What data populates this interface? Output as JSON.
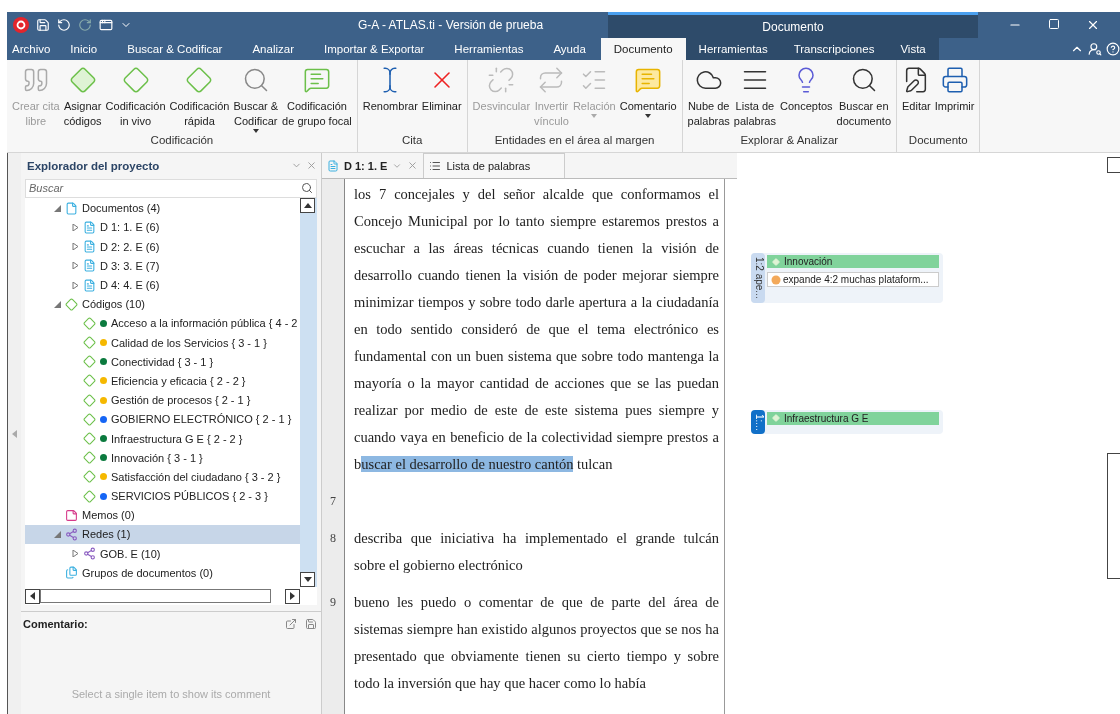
{
  "window": {
    "title": "G-A - ATLAS.ti - Versión de prueba",
    "context_group": "Documento"
  },
  "menu_tabs": [
    {
      "label": "Archivo",
      "selected": false,
      "contextual": false
    },
    {
      "label": "Inicio",
      "selected": false,
      "contextual": false
    },
    {
      "label": "Buscar & Codificar",
      "selected": false,
      "contextual": false
    },
    {
      "label": "Analizar",
      "selected": false,
      "contextual": false
    },
    {
      "label": "Importar & Exportar",
      "selected": false,
      "contextual": false
    },
    {
      "label": "Herramientas",
      "selected": false,
      "contextual": false
    },
    {
      "label": "Ayuda",
      "selected": false,
      "contextual": false
    },
    {
      "label": "Documento",
      "selected": true,
      "contextual": true
    },
    {
      "label": "Herramientas",
      "selected": false,
      "contextual": true
    },
    {
      "label": "Transcripciones",
      "selected": false,
      "contextual": true
    },
    {
      "label": "Vista",
      "selected": false,
      "contextual": true
    }
  ],
  "ribbon": [
    {
      "title": "Codificación",
      "buttons": [
        {
          "label": "Crear cita\nlibre",
          "disabled": true,
          "dropdown": false
        },
        {
          "label": "Asignar\ncódigos",
          "disabled": false,
          "dropdown": false
        },
        {
          "label": "Codificación\nin vivo",
          "disabled": false,
          "dropdown": false
        },
        {
          "label": "Codificación\nrápida",
          "disabled": false,
          "dropdown": false
        },
        {
          "label": "Buscar &\nCodificar",
          "disabled": false,
          "dropdown": true
        },
        {
          "label": "Codificación\nde grupo focal",
          "disabled": false,
          "dropdown": false
        }
      ]
    },
    {
      "title": "Cita",
      "buttons": [
        {
          "label": "Renombrar",
          "disabled": false,
          "dropdown": false
        },
        {
          "label": "Eliminar",
          "disabled": false,
          "dropdown": false
        }
      ]
    },
    {
      "title": "Entidades en el área al margen",
      "buttons": [
        {
          "label": "Desvincular",
          "disabled": true,
          "dropdown": false
        },
        {
          "label": "Invertir\nvínculo",
          "disabled": true,
          "dropdown": false
        },
        {
          "label": "Relación",
          "disabled": true,
          "dropdown": true
        },
        {
          "label": "Comentario",
          "disabled": false,
          "dropdown": true
        }
      ]
    },
    {
      "title": "Explorar & Analizar",
      "buttons": [
        {
          "label": "Nube de\npalabras",
          "disabled": false,
          "dropdown": false
        },
        {
          "label": "Lista de\npalabras",
          "disabled": false,
          "dropdown": false
        },
        {
          "label": "Conceptos",
          "disabled": false,
          "dropdown": false
        },
        {
          "label": "Buscar en\ndocumento",
          "disabled": false,
          "dropdown": false
        }
      ]
    },
    {
      "title": "Documento",
      "buttons": [
        {
          "label": "Editar",
          "disabled": false,
          "dropdown": false
        },
        {
          "label": "Imprimir",
          "disabled": false,
          "dropdown": false
        }
      ]
    }
  ],
  "explorer": {
    "title": "Explorador del proyecto",
    "search": {
      "placeholder": "Buscar"
    },
    "tree": [
      {
        "label": "Documentos (4)",
        "kind": "folder",
        "expanded": true,
        "selected": false,
        "children": [
          {
            "label": "D 1: 1. E (6)",
            "kind": "document",
            "expanded": false,
            "selected": false
          },
          {
            "label": "D 2: 2. E (6)",
            "kind": "document",
            "expanded": false,
            "selected": false
          },
          {
            "label": "D 3: 3. E (7)",
            "kind": "document",
            "expanded": false,
            "selected": false
          },
          {
            "label": "D 4: 4. E (6)",
            "kind": "document",
            "expanded": false,
            "selected": false
          }
        ]
      },
      {
        "label": "Códigos (10)",
        "kind": "codes",
        "expanded": true,
        "selected": false,
        "children": [
          {
            "label": "Acceso a la información pública { 4 - 2",
            "kind": "code",
            "color": "#0b7a3e",
            "selected": false
          },
          {
            "label": "Calidad de los Servicios { 3 - 1 }",
            "kind": "code",
            "color": "#f5b800",
            "selected": false
          },
          {
            "label": "Conectividad { 3 - 1 }",
            "kind": "code",
            "color": "#0b7a3e",
            "selected": false
          },
          {
            "label": "Eficiencia y eficacia { 2 - 2 }",
            "kind": "code",
            "color": "#f5b800",
            "selected": false
          },
          {
            "label": "Gestión de procesos { 2 - 1 }",
            "kind": "code",
            "color": "#f5b800",
            "selected": false
          },
          {
            "label": "GOBIERNO ELECTRÓNICO { 2 - 1 }",
            "kind": "code",
            "color": "#1565f5",
            "selected": false
          },
          {
            "label": "Infraestructura G E { 2 - 2 }",
            "kind": "code",
            "color": "#0b7a3e",
            "selected": false
          },
          {
            "label": "Innovación { 3 - 1 }",
            "kind": "code",
            "color": "#0b7a3e",
            "selected": false
          },
          {
            "label": "Satisfacción del ciudadano { 3 - 2 }",
            "kind": "code",
            "color": "#f5b800",
            "selected": false
          },
          {
            "label": "SERVICIOS PÚBLICOS { 2 - 3 }",
            "kind": "code",
            "color": "#1565f5",
            "selected": false
          }
        ]
      },
      {
        "label": "Memos (0)",
        "kind": "memo",
        "selected": false
      },
      {
        "label": "Redes (1)",
        "kind": "network",
        "expanded": true,
        "selected": true,
        "children": [
          {
            "label": "GOB. E (10)",
            "kind": "network",
            "expanded": false,
            "selected": false
          }
        ]
      },
      {
        "label": "Grupos de documentos (0)",
        "kind": "group",
        "selected": false
      }
    ]
  },
  "comment_panel": {
    "title": "Comentario:",
    "placeholder": "Select a single item to show its comment"
  },
  "doc_tabs": [
    {
      "label": "D 1: 1. E",
      "selected": true
    },
    {
      "label": "Lista de palabras",
      "selected": false
    }
  ],
  "paragraphs": [
    {
      "segments": [
        {
          "text": "los 7 concejales y del señor alcalde que conformamos el Concejo Municipal por lo tanto siempre estaremos prestos a escuchar a las áreas técnicas cuando tienen la visión de desarrollo cuando tienen la visión de poder mejorar siempre minimizar tiempos y sobre todo darle apertura a la ciudadanía en todo sentido consideró de que el tema electrónico es fundamental con un buen sistema que sobre todo mantenga la mayoría o la mayor cantidad de acciones que se las puedan realizar por medio de este de este sistema pues siempre y cuando vaya en beneficio de la colectividad siempre prestos a b",
          "highlighted": false
        },
        {
          "text": "uscar el desarrollo de nuestro cantón",
          "highlighted": true
        },
        {
          "text": " tulcan",
          "highlighted": false
        }
      ]
    },
    {
      "number": "7"
    },
    {
      "number": "8",
      "segments": [
        {
          "text": "describa que iniciativa ha implementado el grande tulcán sobre el gobierno electrónico",
          "highlighted": false
        }
      ]
    },
    {
      "number": "9",
      "segments": [
        {
          "text": "bueno les puedo o comentar de que de parte del área de sistemas siempre han existido algunos proyectos que se nos ha presentado que obviamente tienen su cierto tiempo y sobre todo la inversión que hay que hacer como lo había",
          "highlighted": false
        }
      ]
    }
  ],
  "margin": [
    {
      "quotation": "1:2 ape...",
      "selected": false,
      "code": "Innovación",
      "link": "expande 4:2 muchas plataform..."
    },
    {
      "quotation": "1:...",
      "selected": true,
      "code": "Infraestructura G E"
    }
  ]
}
